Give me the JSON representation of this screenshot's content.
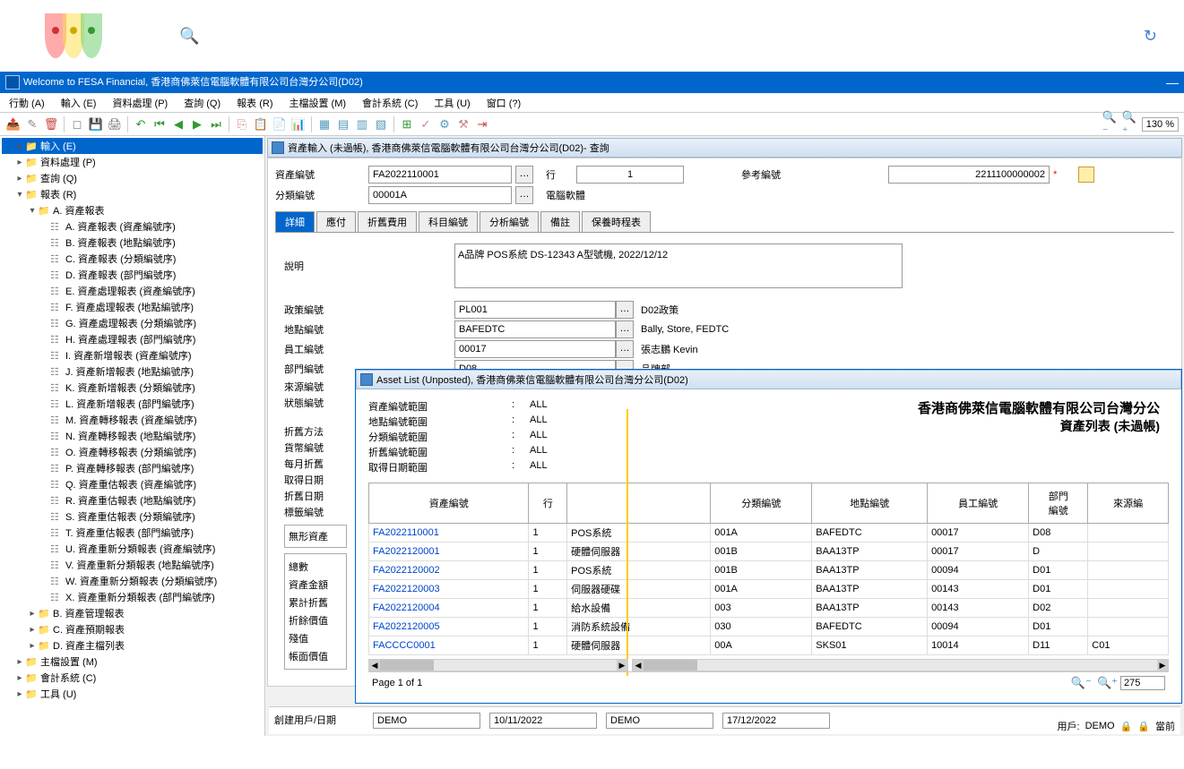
{
  "app_title": "Welcome to FESA Financial, 香港商佛萊信電腦軟體有限公司台灣分公司(D02)",
  "menus": [
    "行動 (A)",
    "輸入 (E)",
    "資料處理 (P)",
    "查詢 (Q)",
    "報表 (R)",
    "主檔設置 (M)",
    "會計系統 (C)",
    "工具 (U)",
    "窗口 (?)"
  ],
  "zoom_value": "130 %",
  "tree": {
    "input": "輸入 (E)",
    "process": "資料處理 (P)",
    "query": "查詢 (Q)",
    "report": "報表 (R)",
    "asset_reports": "A. 資產報表",
    "items": [
      "A. 資產報表 (資產編號序)",
      "B. 資產報表 (地點編號序)",
      "C. 資產報表 (分類編號序)",
      "D. 資產報表 (部門編號序)",
      "E. 資產處理報表 (資產編號序)",
      "F. 資產處理報表 (地點編號序)",
      "G. 資產處理報表 (分類編號序)",
      "H. 資產處理報表 (部門編號序)",
      "I. 資產新增報表 (資產編號序)",
      "J. 資產新增報表 (地點編號序)",
      "K. 資產新增報表 (分類編號序)",
      "L. 資產新增報表 (部門編號序)",
      "M. 資產轉移報表 (資產編號序)",
      "N. 資產轉移報表 (地點編號序)",
      "O. 資產轉移報表 (分類編號序)",
      "P. 資產轉移報表 (部門編號序)",
      "Q. 資產重估報表 (資產編號序)",
      "R. 資產重估報表 (地點編號序)",
      "S. 資產重估報表 (分類編號序)",
      "T. 資產重估報表 (部門編號序)",
      "U. 資產重新分類報表 (資產編號序)",
      "V. 資產重新分類報表 (地點編號序)",
      "W. 資產重新分類報表 (分類編號序)",
      "X. 資產重新分類報表 (部門編號序)"
    ],
    "b_group": "B. 資產管理報表",
    "c_group": "C. 資產預期報表",
    "d_group": "D. 資產主檔列表",
    "master": "主檔設置 (M)",
    "accounting": "會計系統 (C)",
    "tools": "工具 (U)"
  },
  "form": {
    "window_title": "資產輸入 (未過帳), 香港商佛萊信電腦軟體有限公司台灣分公司(D02)- 查詢",
    "asset_no_lbl": "資產編號",
    "asset_no": "FA2022110001",
    "line_lbl": "行",
    "line": "1",
    "ref_lbl": "參考編號",
    "ref": "2211100000002",
    "cat_lbl": "分類編號",
    "cat": "00001A",
    "cat_desc": "電腦軟體",
    "tabs": [
      "詳細",
      "應付",
      "折舊費用",
      "科目編號",
      "分析編號",
      "備註",
      "保養時程表"
    ],
    "desc_lbl": "說明",
    "desc": "A品牌 POS系統 DS-12343 A型號機, 2022/12/12",
    "policy_lbl": "政策編號",
    "policy": "PL001",
    "policy_desc": "D02政策",
    "loc_lbl": "地點編號",
    "loc": "BAFEDTC",
    "loc_desc": "Bally, Store, FEDTC",
    "emp_lbl": "員工編號",
    "emp": "00017",
    "emp_desc": "張志鵬 Kevin",
    "dept_lbl": "部門編號",
    "dept": "D08",
    "dept_desc": "品牌部",
    "source_lbl": "來源編號",
    "status_lbl": "狀態編號",
    "left_labels": [
      "折舊方法",
      "貨幣編號",
      "每月折舊",
      "取得日期",
      "折舊日期",
      "標籤編號"
    ],
    "summary_header": "無形資產",
    "summary": [
      "總數",
      "資產金額",
      "累計折舊",
      "折餘價值",
      "殘值",
      "帳面價值"
    ]
  },
  "report": {
    "window_title": "Asset List (Unposted), 香港商佛萊信電腦軟體有限公司台灣分公司(D02)",
    "filters": [
      {
        "lbl": "資產編號範圍",
        "val": "ALL"
      },
      {
        "lbl": "地點編號範圍",
        "val": "ALL"
      },
      {
        "lbl": "分類編號範圍",
        "val": "ALL"
      },
      {
        "lbl": "折舊編號範圍",
        "val": "ALL"
      },
      {
        "lbl": "取得日期範圍",
        "val": "ALL"
      }
    ],
    "company": "香港商佛萊信電腦軟體有限公司台灣分公",
    "title": "資產列表 (未過帳)",
    "cols": [
      "資產編號",
      "行",
      "",
      "分類編號",
      "地點編號",
      "員工編號",
      "部門\n編號",
      "來源編"
    ],
    "rows": [
      [
        "FA2022110001",
        "1",
        "POS系統",
        "001A",
        "BAFEDTC",
        "00017",
        "D08",
        ""
      ],
      [
        "FA2022120001",
        "1",
        "硬體伺服器",
        "001B",
        "BAA13TP",
        "00017",
        "D",
        ""
      ],
      [
        "FA2022120002",
        "1",
        "POS系統",
        "001B",
        "BAA13TP",
        "00094",
        "D01",
        ""
      ],
      [
        "FA2022120003",
        "1",
        "伺服器硬碟",
        "001A",
        "BAA13TP",
        "00143",
        "D01",
        ""
      ],
      [
        "FA2022120004",
        "1",
        "給水設備",
        "003",
        "BAA13TP",
        "00143",
        "D02",
        ""
      ],
      [
        "FA2022120005",
        "1",
        "消防系統設備",
        "030",
        "BAFEDTC",
        "00094",
        "D01",
        ""
      ],
      [
        "FACCCC0001",
        "1",
        "硬體伺服器",
        "00A",
        "SKS01",
        "10014",
        "D11",
        "C01"
      ]
    ],
    "page_info": "Page 1 of 1",
    "page_input": "275"
  },
  "footer": {
    "create_lbl": "創建用戶/日期",
    "user1": "DEMO",
    "date1": "10/11/2022",
    "user2": "DEMO",
    "date2": "17/12/2022",
    "status_user_lbl": "用戶:",
    "status_user": "DEMO",
    "status_right": "當前"
  }
}
